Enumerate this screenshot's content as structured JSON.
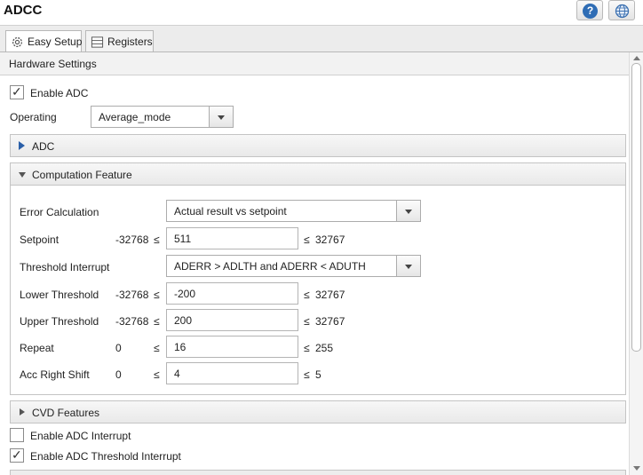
{
  "window": {
    "title": "ADCC"
  },
  "tabs": [
    {
      "label": "Easy Setup"
    },
    {
      "label": "Registers"
    }
  ],
  "hardware": {
    "header": "Hardware Settings",
    "enable_adc": {
      "label": "Enable ADC",
      "checked": true
    },
    "operating": {
      "label": "Operating",
      "value": "Average_mode"
    }
  },
  "sections": {
    "adc": "ADC",
    "computation": "Computation Feature",
    "cvd": "CVD Features"
  },
  "computation": {
    "error_calculation": {
      "label": "Error Calculation",
      "value": "Actual result vs setpoint"
    },
    "threshold_interrupt": {
      "label": "Threshold Interrupt",
      "value": "ADERR > ADLTH and ADERR < ADUTH"
    },
    "le": "≤",
    "rows": [
      {
        "label": "Setpoint",
        "min": "-32768",
        "value": "511",
        "max": "32767"
      },
      {
        "label": "Lower Threshold",
        "min": "-32768",
        "value": "-200",
        "max": "32767"
      },
      {
        "label": "Upper Threshold",
        "min": "-32768",
        "value": "200",
        "max": "32767"
      },
      {
        "label": "Repeat",
        "min": "0",
        "value": "16",
        "max": "255"
      },
      {
        "label": "Acc Right Shift",
        "min": "0",
        "value": "4",
        "max": "5"
      }
    ]
  },
  "interrupts": {
    "enable_adc_interrupt": {
      "label": "Enable ADC Interrupt",
      "checked": false
    },
    "enable_adc_threshold_interrupt": {
      "label": "Enable ADC Threshold Interrupt",
      "checked": true
    }
  },
  "icons": {
    "help": "help-icon",
    "globe": "globe-icon",
    "gear": "gear-icon",
    "registers": "table-icon",
    "check": "✓"
  },
  "colors": {
    "accent": "#2f6db5",
    "expand_arrow": "#2a5fa8"
  }
}
